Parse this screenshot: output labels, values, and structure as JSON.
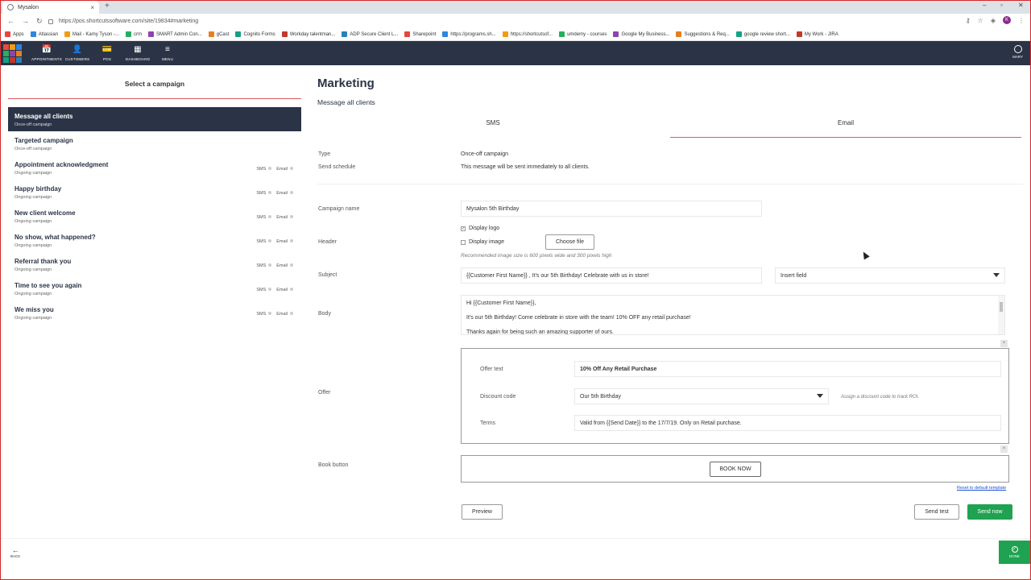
{
  "browser": {
    "tab_title": "Mysalon",
    "tab_close": "×",
    "new_tab": "+",
    "url": "https://pos.shortcutssoftware.com/site/19834#marketing",
    "profile_initial": "K",
    "bookmarks": [
      "Apps",
      "Atlassian",
      "Mail - Kamy Tyson -...",
      "crm",
      "SMART Admin Con...",
      "gCast",
      "Cognito Forms",
      "Workday talentman...",
      "ADP Secure Client L...",
      "Sharepoint",
      "https://programs.sh...",
      "https://shortcutsof...",
      "umdemy - courses",
      "Google My Business...",
      "Suggestions & Req...",
      "google review short...",
      "My Work - JIRA"
    ]
  },
  "app": {
    "nav": [
      {
        "label": "APPOINTMENTS",
        "icon": "📅"
      },
      {
        "label": "CUSTOMERS",
        "icon": "👤"
      },
      {
        "label": "POS",
        "icon": "💳"
      },
      {
        "label": "DASHBOARD",
        "icon": "▦"
      },
      {
        "label": "MENU",
        "icon": "≡"
      }
    ],
    "user": "MARY"
  },
  "left": {
    "title": "Select a campaign",
    "campaigns": [
      {
        "name": "Message all clients",
        "sub": "Once-off campaign",
        "sms": "",
        "email": ""
      },
      {
        "name": "Targeted campaign",
        "sub": "Once-off campaign",
        "sms": "",
        "email": ""
      },
      {
        "name": "Appointment acknowledgment",
        "sub": "Ongoing campaign",
        "sms": "SMS",
        "email": "Email"
      },
      {
        "name": "Happy birthday",
        "sub": "Ongoing campaign",
        "sms": "SMS",
        "email": "Email"
      },
      {
        "name": "New client welcome",
        "sub": "Ongoing campaign",
        "sms": "SMS",
        "email": "Email"
      },
      {
        "name": "No show, what happened?",
        "sub": "Ongoing campaign",
        "sms": "SMS",
        "email": "Email"
      },
      {
        "name": "Referral thank you",
        "sub": "Ongoing campaign",
        "sms": "SMS",
        "email": "Email"
      },
      {
        "name": "Time to see you again",
        "sub": "Ongoing campaign",
        "sms": "SMS",
        "email": "Email"
      },
      {
        "name": "We miss you",
        "sub": "Ongoing campaign",
        "sms": "SMS",
        "email": "Email"
      }
    ]
  },
  "main": {
    "title": "Marketing",
    "subtitle": "Message all clients",
    "tabs": [
      "SMS",
      "Email"
    ],
    "type_label": "Type",
    "type_value": "Once-off campaign",
    "schedule_label": "Send schedule",
    "schedule_value": "This message will be sent immediately to all clients.",
    "campaign_name_label": "Campaign name",
    "campaign_name_value": "Mysalon 5th Birthday",
    "header_label": "Header",
    "display_logo": "Display logo",
    "display_image": "Display image",
    "choose_file": "Choose file",
    "image_hint": "Recommended image size is 600 pixels wide and 300 pixels high",
    "subject_label": "Subject",
    "subject_value": "{{Customer First Name}} , It's our 5th Birthday! Celebrate with us in store!",
    "insert_field": "Insert field",
    "body_label": "Body",
    "body_lines": [
      "Hi {{Customer First Name}},",
      "It's our 5th Birthday! Come celebrate in store with the team! 10% OFF any retail purchase!",
      "Thanks again for being such an amazing supporter of ours."
    ],
    "offer_label": "Offer",
    "offer_text_label": "Offer text",
    "offer_text_value": "10% Off Any Retail Purchase",
    "discount_label": "Discount code",
    "discount_value": "Our 5th Birthday",
    "discount_hint": "Assign a discount code to track ROI.",
    "terms_label": "Terms",
    "terms_value": "Valid from {{Send Date}} to the 17/7/19. Only on Retail purchase.",
    "book_label": "Book button",
    "book_now": "BOOK NOW",
    "reset_link": "Reset to default template",
    "preview": "Preview",
    "send_test": "Send test",
    "send_now": "Send now",
    "close_glyph": "×"
  },
  "footer": {
    "back": "BACK",
    "done": "DONE"
  },
  "colors": {
    "navbar": "#2a3446",
    "accent_red": "#e05a5a",
    "green": "#1fa251"
  }
}
